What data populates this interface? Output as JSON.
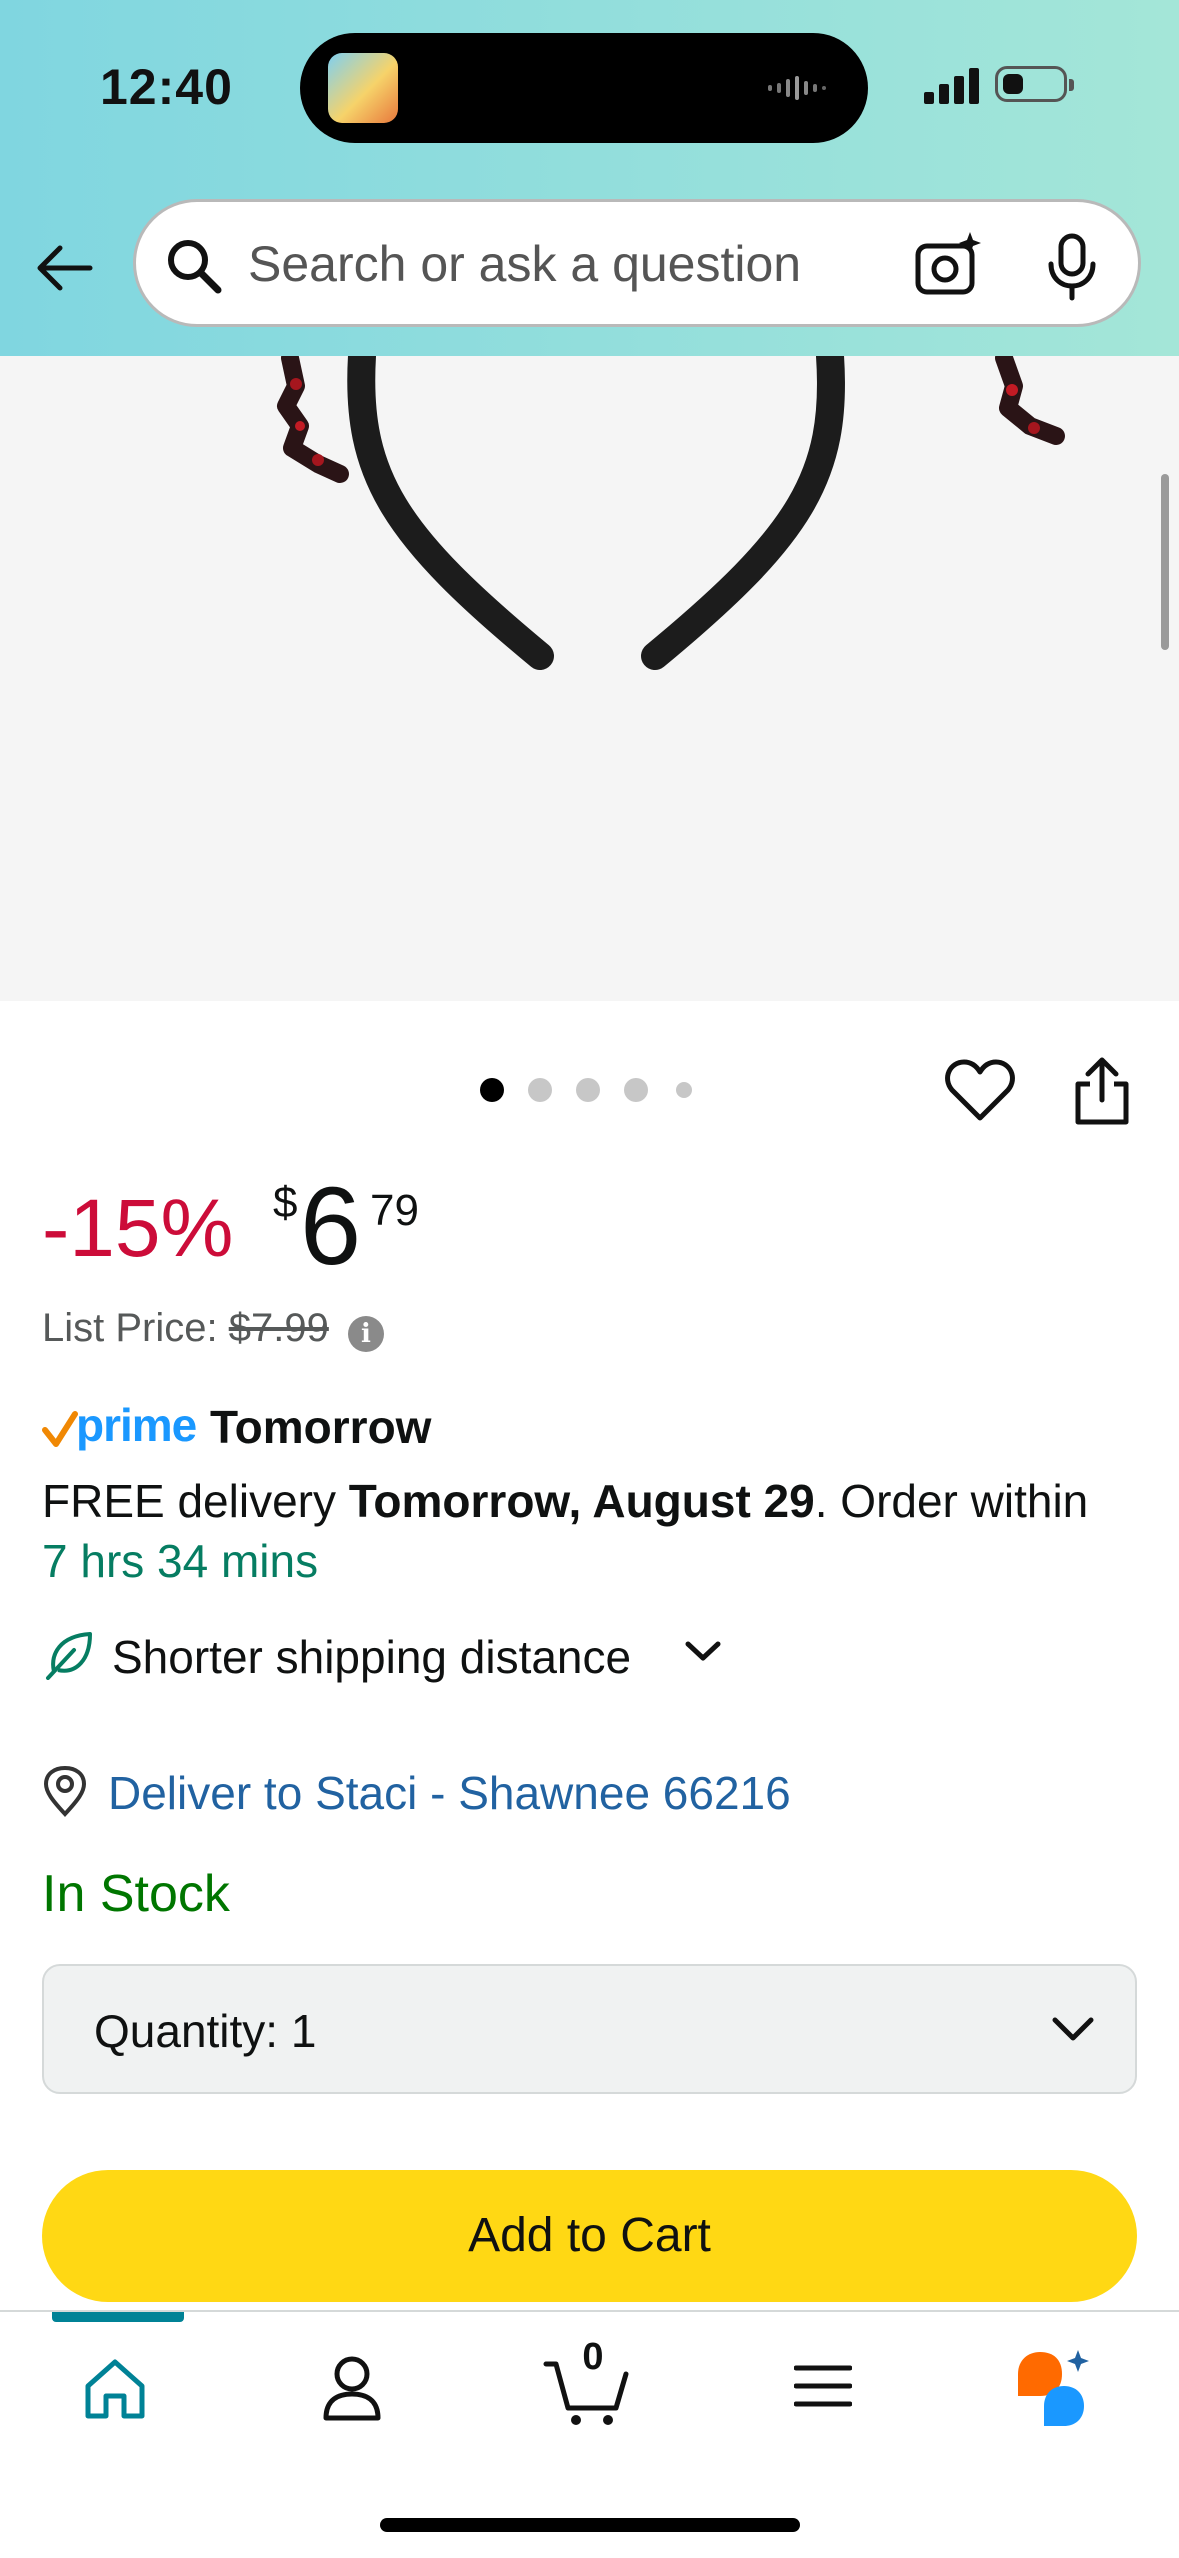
{
  "status_bar": {
    "time": "12:40"
  },
  "search": {
    "placeholder": "Search or ask a question"
  },
  "product": {
    "discount": "-15%",
    "price_symbol": "$",
    "price_whole": "6",
    "price_fraction": "79",
    "list_price_label": "List Price:",
    "list_price_value": "$7.99",
    "image_count": 5,
    "active_image": 1
  },
  "delivery": {
    "prime_label": "prime",
    "prime_speed": "Tomorrow",
    "free_delivery_prefix": "FREE delivery ",
    "delivery_date": "Tomorrow, August 29",
    "order_within_text": ". Order within",
    "countdown": "7 hrs 34 mins",
    "shipping_note": "Shorter shipping distance",
    "deliver_to": "Deliver to Staci - Shawnee 66216"
  },
  "stock": {
    "status": "In Stock"
  },
  "quantity": {
    "label": "Quantity:",
    "value": "1"
  },
  "actions": {
    "add_to_cart": "Add to Cart"
  },
  "bottom_nav": {
    "cart_count": "0",
    "items": [
      "home-icon",
      "account-icon",
      "cart-icon",
      "menu-icon",
      "rufus-icon"
    ],
    "active": "home"
  },
  "colors": {
    "header_gradient_start": "#80d6e0",
    "header_gradient_end": "#a4e6d8",
    "discount": "#cc0c39",
    "countdown": "#067d62",
    "link": "#2162a1",
    "in_stock": "#007600",
    "add_to_cart": "#ffd814",
    "prime": "#1a98ff",
    "nav_active": "#008296"
  }
}
